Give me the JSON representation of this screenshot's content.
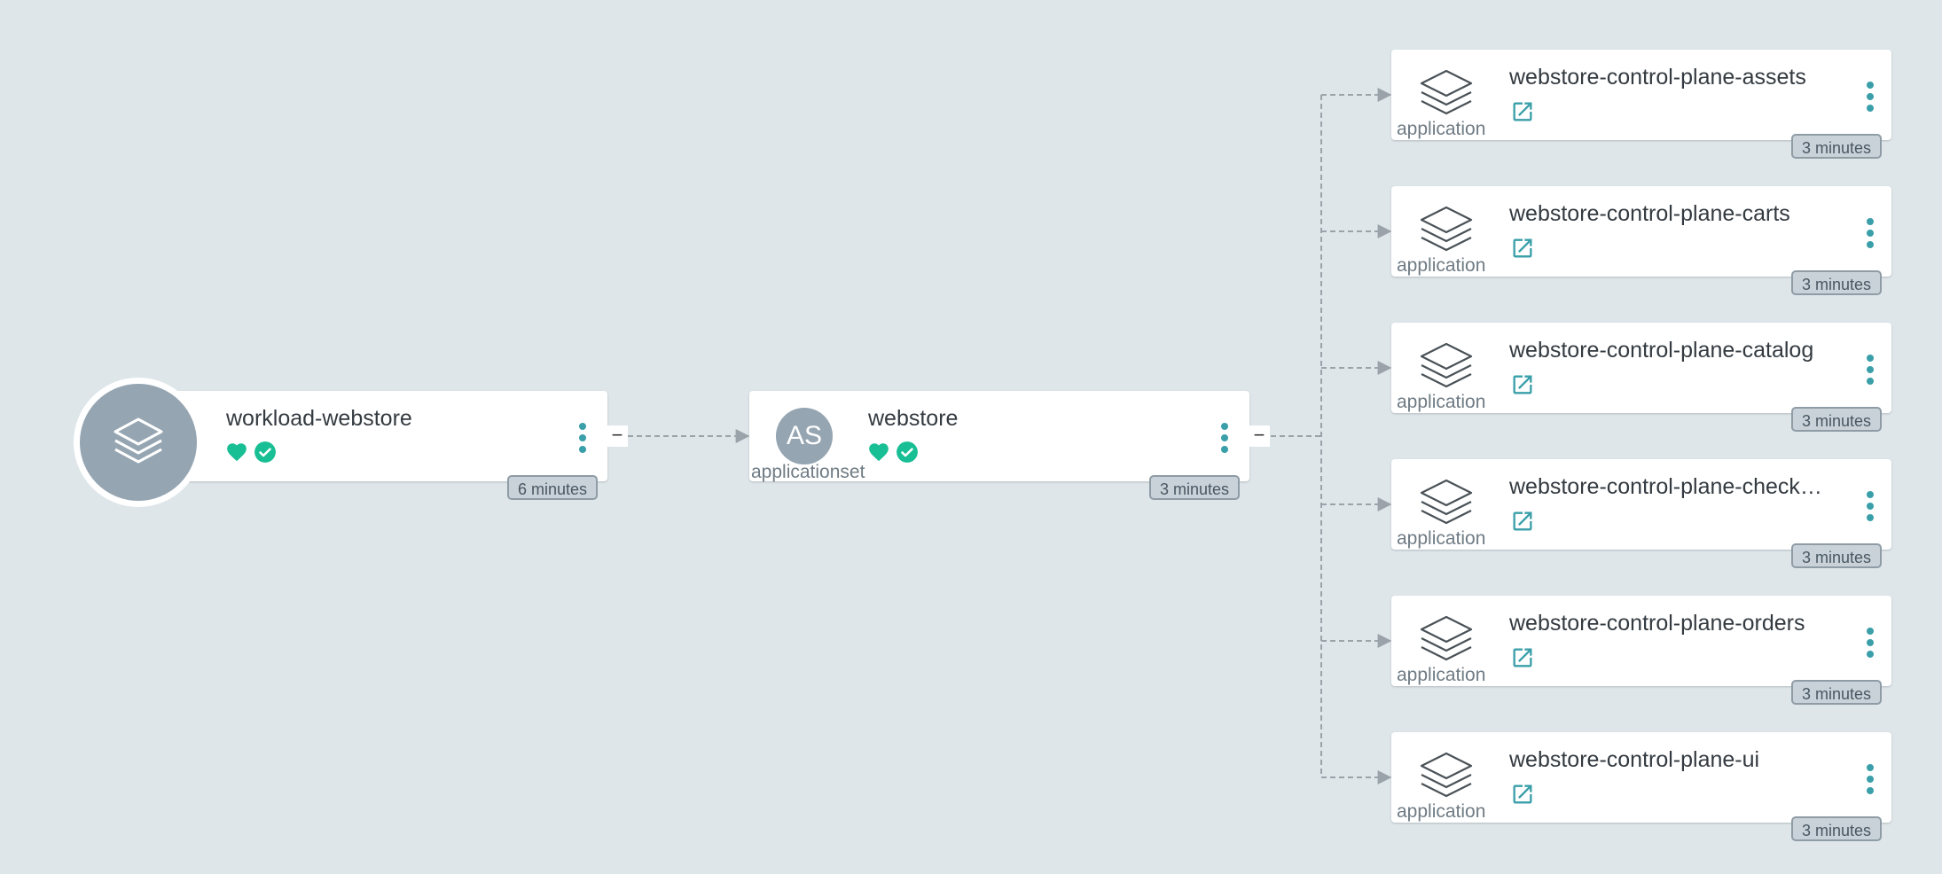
{
  "colors": {
    "background": "#dee6ea",
    "healthy": "#18be94",
    "synced": "#18be94",
    "accent": "#3a9fa9"
  },
  "root": {
    "name": "workload-webstore",
    "icon": "layers-icon",
    "status": [
      "health-heart-icon",
      "sync-check-icon"
    ],
    "age": "6 minutes",
    "collapse_symbol": "−"
  },
  "appset": {
    "name": "webstore",
    "avatar_text": "AS",
    "kind": "applicationset",
    "status": [
      "health-heart-icon",
      "sync-check-icon"
    ],
    "age": "3 minutes",
    "collapse_symbol": "−"
  },
  "applications": [
    {
      "name": "webstore-control-plane-assets",
      "kind": "application",
      "age": "3 minutes"
    },
    {
      "name": "webstore-control-plane-carts",
      "kind": "application",
      "age": "3 minutes"
    },
    {
      "name": "webstore-control-plane-catalog",
      "kind": "application",
      "age": "3 minutes"
    },
    {
      "name": "webstore-control-plane-check…",
      "kind": "application",
      "age": "3 minutes"
    },
    {
      "name": "webstore-control-plane-orders",
      "kind": "application",
      "age": "3 minutes"
    },
    {
      "name": "webstore-control-plane-ui",
      "kind": "application",
      "age": "3 minutes"
    }
  ]
}
